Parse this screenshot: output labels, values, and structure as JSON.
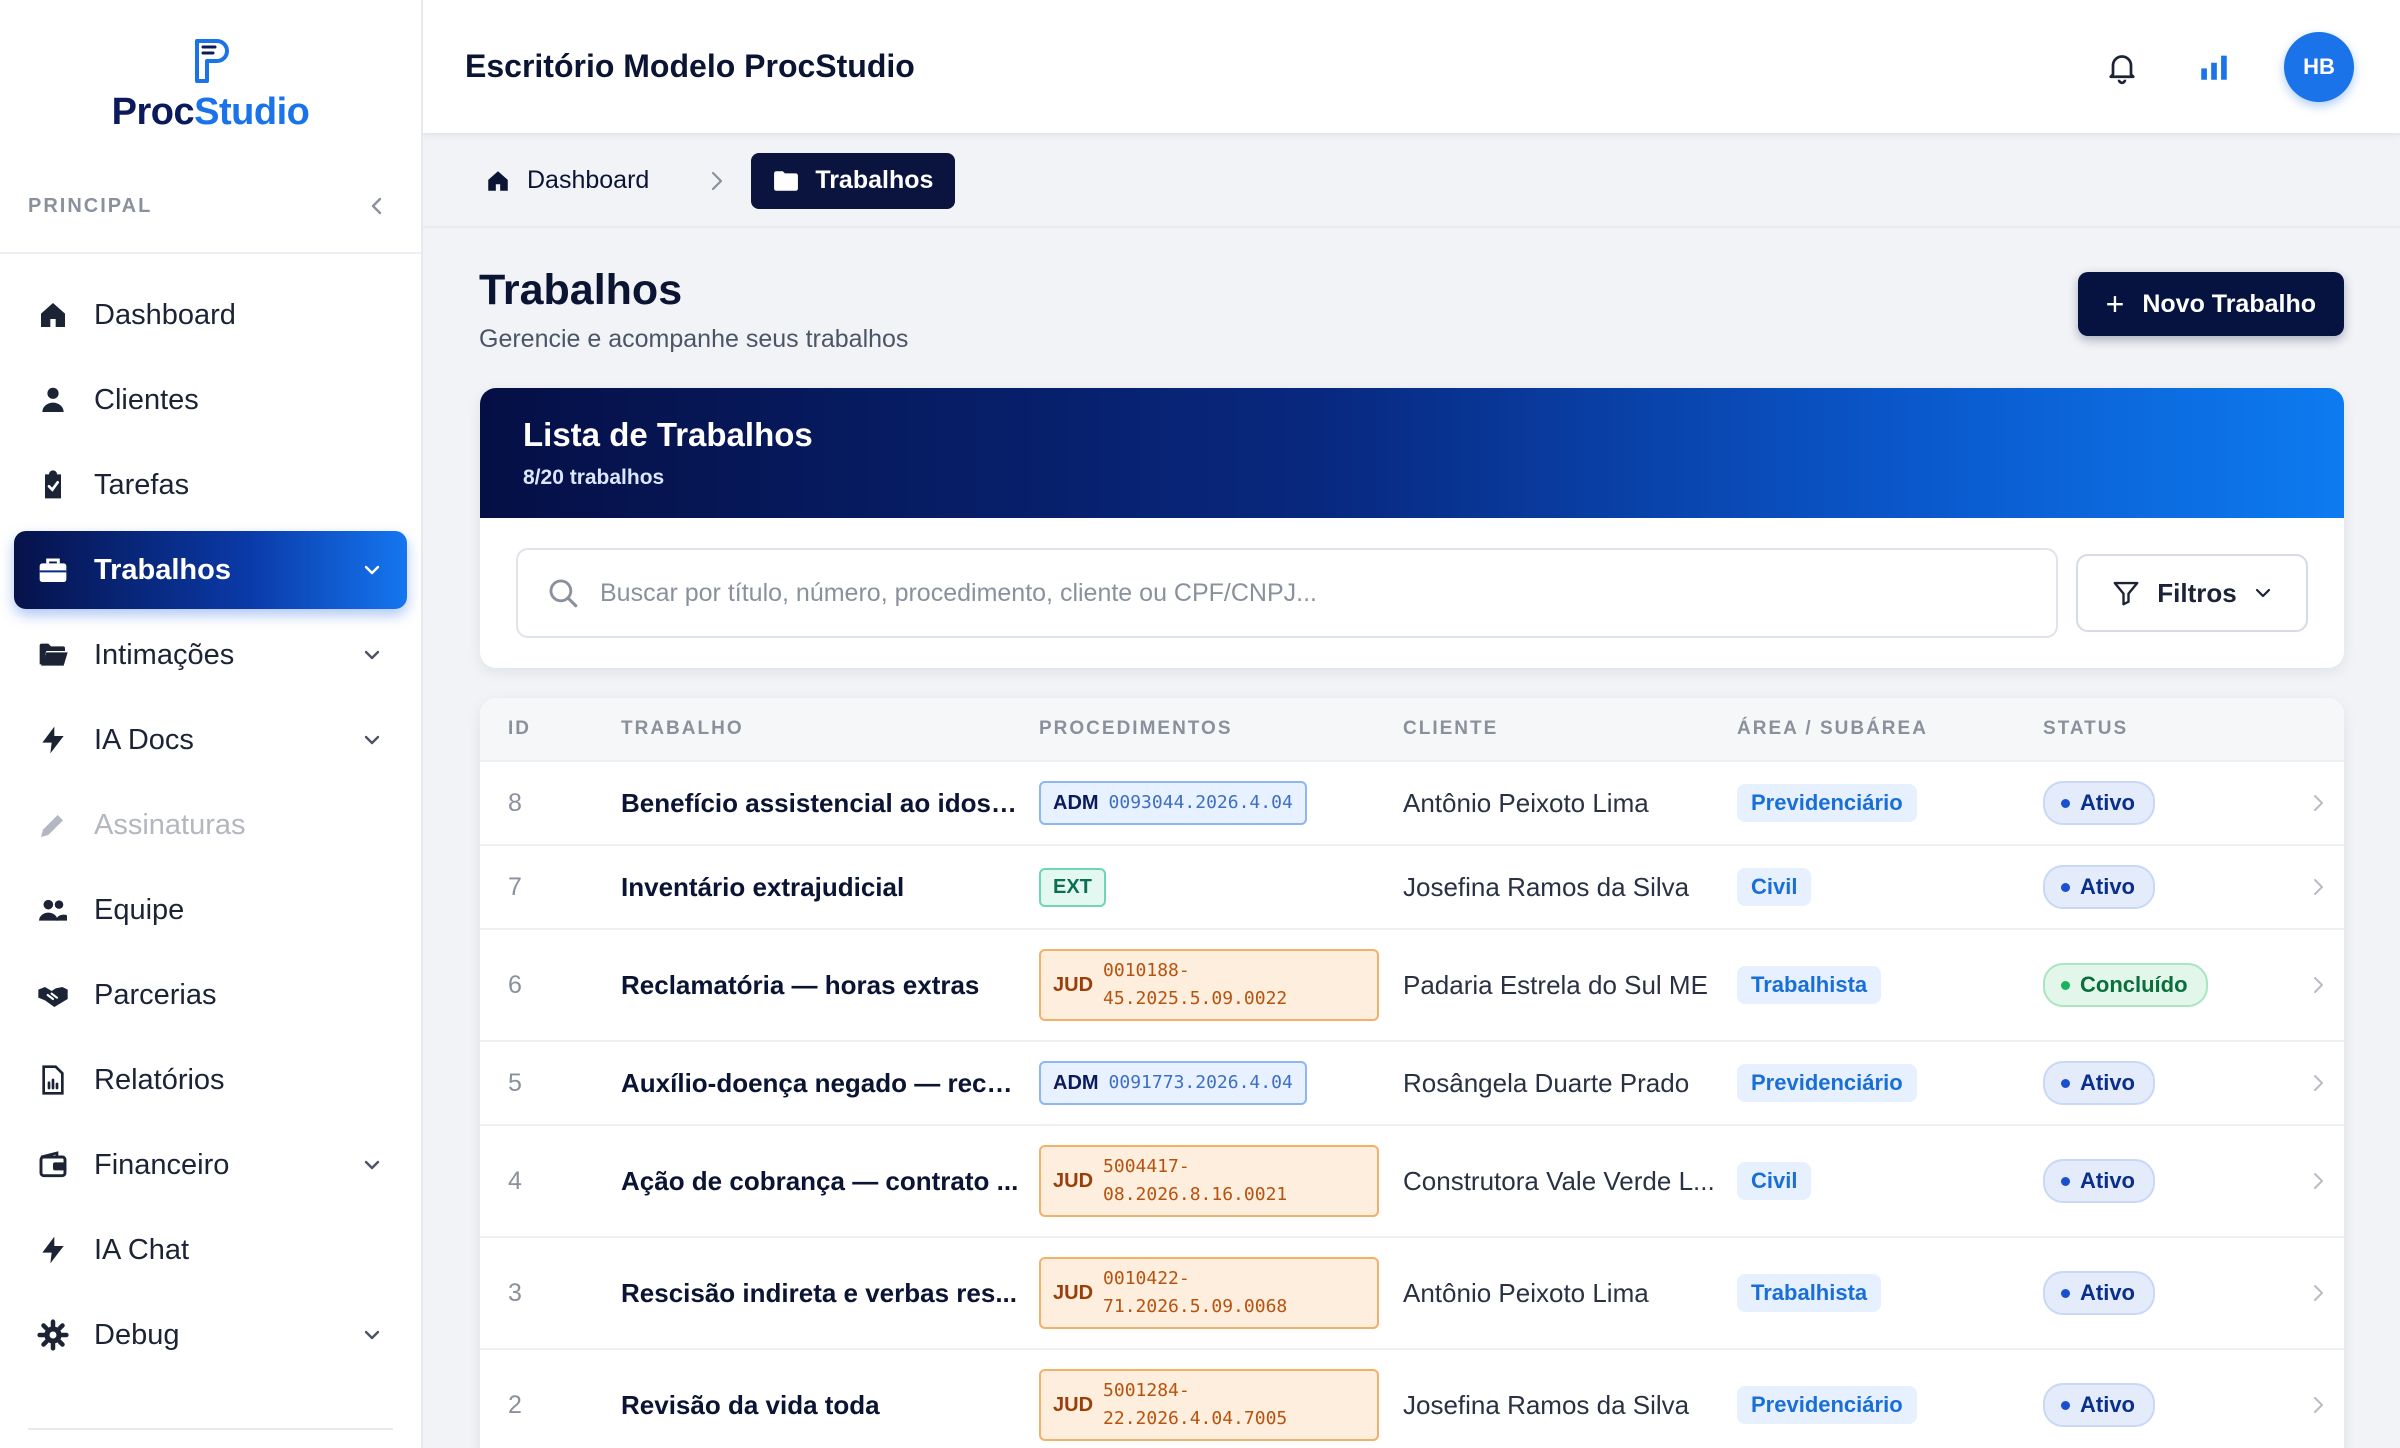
{
  "brand": {
    "name_part1": "Proc",
    "name_part2": "Studio"
  },
  "sidebar": {
    "section_title": "PRINCIPAL",
    "items": [
      {
        "label": "Dashboard",
        "icon": "home-icon",
        "active": false,
        "chevron": false,
        "disabled": false
      },
      {
        "label": "Clientes",
        "icon": "user-icon",
        "active": false,
        "chevron": false,
        "disabled": false
      },
      {
        "label": "Tarefas",
        "icon": "clipboard-check-icon",
        "active": false,
        "chevron": false,
        "disabled": false
      },
      {
        "label": "Trabalhos",
        "icon": "briefcase-icon",
        "active": true,
        "chevron": true,
        "disabled": false
      },
      {
        "label": "Intimações",
        "icon": "folder-open-icon",
        "active": false,
        "chevron": true,
        "disabled": false
      },
      {
        "label": "IA Docs",
        "icon": "bolt-icon",
        "active": false,
        "chevron": true,
        "disabled": false
      },
      {
        "label": "Assinaturas",
        "icon": "pen-icon",
        "active": false,
        "chevron": false,
        "disabled": true
      },
      {
        "label": "Equipe",
        "icon": "users-icon",
        "active": false,
        "chevron": false,
        "disabled": false
      },
      {
        "label": "Parcerias",
        "icon": "handshake-icon",
        "active": false,
        "chevron": false,
        "disabled": false
      },
      {
        "label": "Relatórios",
        "icon": "report-icon",
        "active": false,
        "chevron": false,
        "disabled": false
      },
      {
        "label": "Financeiro",
        "icon": "wallet-icon",
        "active": false,
        "chevron": true,
        "disabled": false
      },
      {
        "label": "IA Chat",
        "icon": "bolt-icon",
        "active": false,
        "chevron": false,
        "disabled": false
      },
      {
        "label": "Debug",
        "icon": "gear-icon",
        "active": false,
        "chevron": true,
        "disabled": false
      }
    ]
  },
  "topbar": {
    "office_title": "Escritório Modelo ProcStudio",
    "avatar_initials": "HB"
  },
  "breadcrumb": {
    "home": "Dashboard",
    "current": "Trabalhos"
  },
  "page": {
    "title": "Trabalhos",
    "subtitle": "Gerencie e acompanhe seus trabalhos",
    "new_button": "Novo Trabalho"
  },
  "list": {
    "title": "Lista de Trabalhos",
    "count": "8/20 trabalhos",
    "search_placeholder": "Buscar por título, número, procedimento, cliente ou CPF/CNPJ...",
    "filter_label": "Filtros"
  },
  "table": {
    "headers": {
      "id": "ID",
      "work": "TRABALHO",
      "proc": "PROCEDIMENTOS",
      "client": "CLIENTE",
      "area": "ÁREA / SUBÁREA",
      "status": "STATUS"
    },
    "rows": [
      {
        "id": "8",
        "work": "Benefício assistencial ao idoso...",
        "proc_type": "ADM",
        "proc_number": "0093044.2026.4.04",
        "client": "Antônio Peixoto Lima",
        "area": "Previdenciário",
        "status": "Ativo"
      },
      {
        "id": "7",
        "work": "Inventário extrajudicial",
        "proc_type": "EXT",
        "proc_number": "",
        "client": "Josefina Ramos da Silva",
        "area": "Civil",
        "status": "Ativo"
      },
      {
        "id": "6",
        "work": "Reclamatória — horas extras",
        "proc_type": "JUD",
        "proc_number": "0010188-\n45.2025.5.09.0022",
        "client": "Padaria Estrela do Sul ME",
        "area": "Trabalhista",
        "status": "Concluído"
      },
      {
        "id": "5",
        "work": "Auxílio-doença negado — recu...",
        "proc_type": "ADM",
        "proc_number": "0091773.2026.4.04",
        "client": "Rosângela Duarte Prado",
        "area": "Previdenciário",
        "status": "Ativo"
      },
      {
        "id": "4",
        "work": "Ação de cobrança — contrato ...",
        "proc_type": "JUD",
        "proc_number": "5004417-\n08.2026.8.16.0021",
        "client": "Construtora Vale Verde L...",
        "area": "Civil",
        "status": "Ativo"
      },
      {
        "id": "3",
        "work": "Rescisão indireta e verbas res...",
        "proc_type": "JUD",
        "proc_number": "0010422-\n71.2026.5.09.0068",
        "client": "Antônio Peixoto Lima",
        "area": "Trabalhista",
        "status": "Ativo"
      },
      {
        "id": "2",
        "work": "Revisão da vida toda",
        "proc_type": "JUD",
        "proc_number": "5001284-\n22.2026.4.04.7005",
        "client": "Josefina Ramos da Silva",
        "area": "Previdenciário",
        "status": "Ativo"
      }
    ]
  },
  "colors": {
    "brand_navy": "#06123f",
    "brand_blue": "#1a73e8",
    "accent_gradient_end": "#0d7bf0"
  }
}
